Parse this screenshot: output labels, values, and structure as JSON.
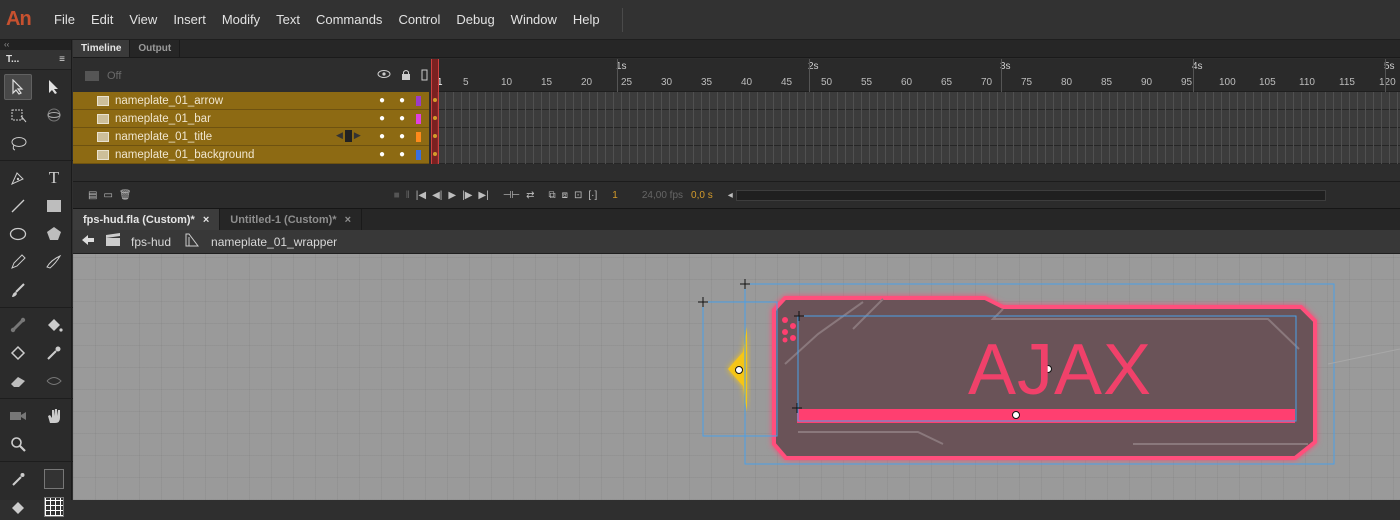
{
  "app": {
    "logo": "An"
  },
  "menu": [
    "File",
    "Edit",
    "View",
    "Insert",
    "Modify",
    "Text",
    "Commands",
    "Control",
    "Debug",
    "Window",
    "Help"
  ],
  "tools_panel": {
    "title": "T..."
  },
  "timeline": {
    "tabs": [
      "Timeline",
      "Output"
    ],
    "off_label": "Off",
    "layers": [
      {
        "name": "nameplate_01_arrow",
        "color": "#9b3cc8"
      },
      {
        "name": "nameplate_01_bar",
        "color": "#e040e0"
      },
      {
        "name": "nameplate_01_title",
        "color": "#ff8a1a"
      },
      {
        "name": "nameplate_01_background",
        "color": "#3a6fe0"
      }
    ],
    "seconds": [
      "1s",
      "2s",
      "3s",
      "4s",
      "5s"
    ],
    "frame_numbers": [
      "1",
      "5",
      "10",
      "15",
      "20",
      "25",
      "30",
      "35",
      "40",
      "45",
      "50",
      "55",
      "60",
      "65",
      "70",
      "75",
      "80",
      "85",
      "90",
      "95",
      "100",
      "105",
      "110",
      "115",
      "120"
    ],
    "current_frame": "1",
    "fps": "24,00 fps",
    "time": "0,0 s"
  },
  "documents": [
    {
      "title": "fps-hud.fla (Custom)*",
      "close": "×",
      "active": true
    },
    {
      "title": "Untitled-1 (Custom)*",
      "close": "×",
      "active": false
    }
  ],
  "breadcrumb": {
    "scene": "fps-hud",
    "symbol": "nameplate_01_wrapper"
  },
  "stage": {
    "nameplate_text": "AJAX",
    "accent_color": "#f0416a",
    "arrow_color": "#f5c518"
  }
}
